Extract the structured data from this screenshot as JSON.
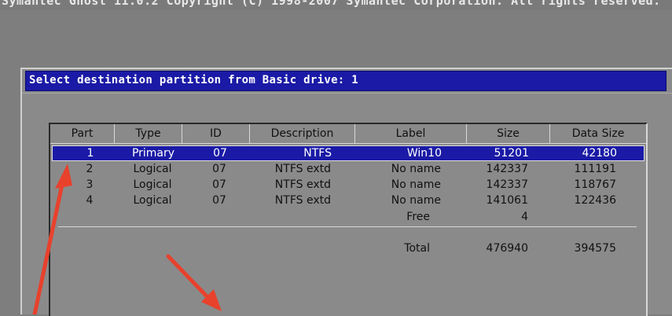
{
  "header": {
    "banner_text": "Symantec Ghost 11.0.2   Copyright (C) 1998-2007 Symantec Corporation. All rights reserved."
  },
  "dialog": {
    "title": "Select destination partition from Basic drive: 1"
  },
  "table": {
    "columns": [
      "Part",
      "Type",
      "ID",
      "Description",
      "Label",
      "Size",
      "Data Size"
    ],
    "rows": [
      {
        "part": "1",
        "type": "Primary",
        "id": "07",
        "description": "NTFS",
        "label": "Win10",
        "size": "51201",
        "data_size": "42180"
      },
      {
        "part": "2",
        "type": "Logical",
        "id": "07",
        "description": "NTFS extd",
        "label": "No name",
        "size": "142337",
        "data_size": "111191"
      },
      {
        "part": "3",
        "type": "Logical",
        "id": "07",
        "description": "NTFS extd",
        "label": "No name",
        "size": "142337",
        "data_size": "118767"
      },
      {
        "part": "4",
        "type": "Logical",
        "id": "07",
        "description": "NTFS extd",
        "label": "No name",
        "size": "141061",
        "data_size": "122436"
      }
    ],
    "free": {
      "label": "Free",
      "size": "4"
    },
    "total": {
      "label": "Total",
      "size": "476940",
      "data_size": "394575"
    },
    "selected_index": 0
  },
  "colors": {
    "background": "#7e7e7e",
    "selection": "#1a1aa6",
    "annotation_arrow": "#e8412c"
  }
}
